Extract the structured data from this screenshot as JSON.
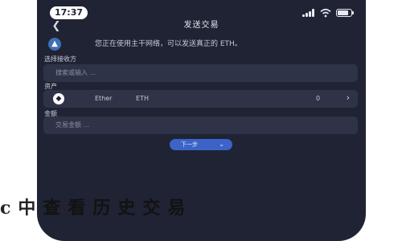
{
  "status_bar": {
    "time": "17:37"
  },
  "header": {
    "back_icon": "chevron-left-icon",
    "title": "发送交易"
  },
  "notice": {
    "icon": "warning-icon",
    "text": "您正在使用主干网络，可以发送真正的 ETH。"
  },
  "network": {
    "label": "选择接收方",
    "placeholder": "搜索或输入 ..."
  },
  "asset": {
    "label": "资产",
    "logo_icon": "ethereum-icon",
    "name": "Ether",
    "symbol": "ETH",
    "balance": "0"
  },
  "amount": {
    "label": "金额",
    "placeholder": "交易金额 ..."
  },
  "next_button": {
    "label": "下一步"
  },
  "overlay_text": "c中查看历史交易",
  "colors": {
    "screen_bg": "#1f2333",
    "field_bg": "#2e3347",
    "accent": "#3c63c8"
  }
}
